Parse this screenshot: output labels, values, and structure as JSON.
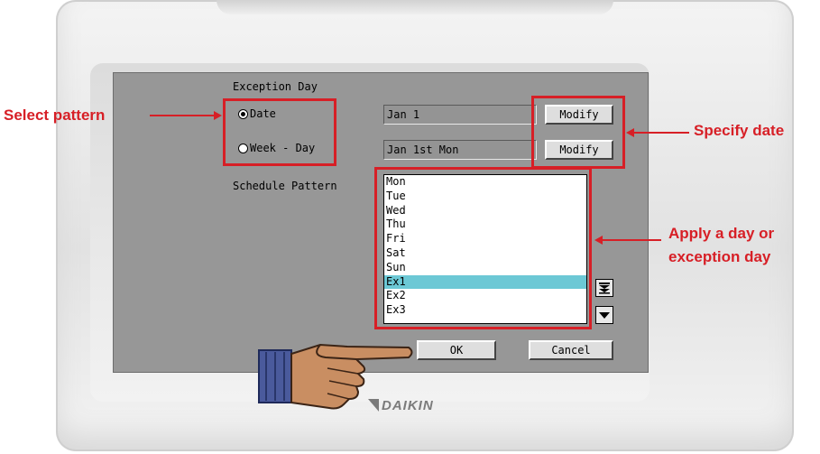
{
  "dialog": {
    "exception_day_label": "Exception Day",
    "radio_date_label": "Date",
    "radio_week_day_label": "Week - Day",
    "selected_mode": "Date",
    "date_value": "Jan 1",
    "week_day_value": "Jan 1st Mon",
    "modify_label": "Modify",
    "schedule_pattern_label": "Schedule Pattern",
    "schedule_items": [
      "Mon",
      "Tue",
      "Wed",
      "Thu",
      "Fri",
      "Sat",
      "Sun",
      "Ex1",
      "Ex2",
      "Ex3"
    ],
    "selected_item": "Ex1",
    "ok_label": "OK",
    "cancel_label": "Cancel"
  },
  "annotations": {
    "select_pattern": "Select pattern",
    "specify_date": "Specify date",
    "apply_line1": "Apply a day or",
    "apply_line2": "exception day"
  },
  "brand": {
    "logo_text": "DAIKIN"
  },
  "icons": {
    "scroll_bottom": "double-down-arrow-icon",
    "scroll_down": "down-arrow-icon",
    "pointer": "pointing-hand-icon"
  },
  "colors": {
    "accent": "#d71f26",
    "selection": "#6cc8d5",
    "screen": "#979797"
  }
}
